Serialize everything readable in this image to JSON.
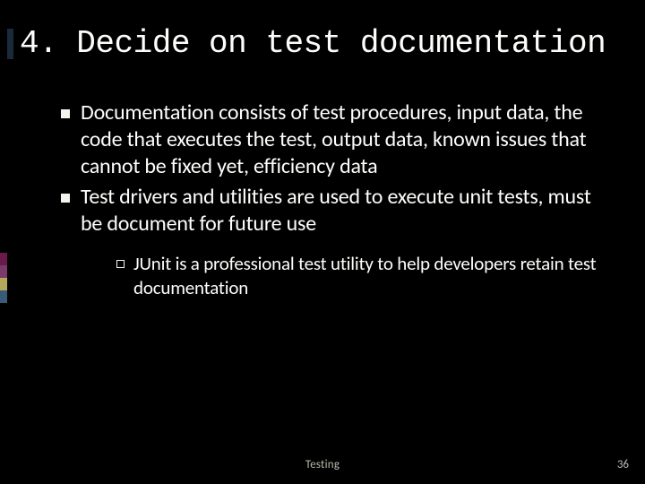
{
  "title": "4. Decide on test documentation",
  "bullets": [
    "Documentation consists of test procedures, input data, the code that executes the test, output data, known issues that cannot be fixed yet, efficiency data",
    "Test drivers and utilities are used to execute unit tests, must be document for future use"
  ],
  "subbullets": [
    "JUnit is a professional test utility to help developers retain test documentation"
  ],
  "footer": {
    "label": "Testing",
    "page": "36"
  }
}
